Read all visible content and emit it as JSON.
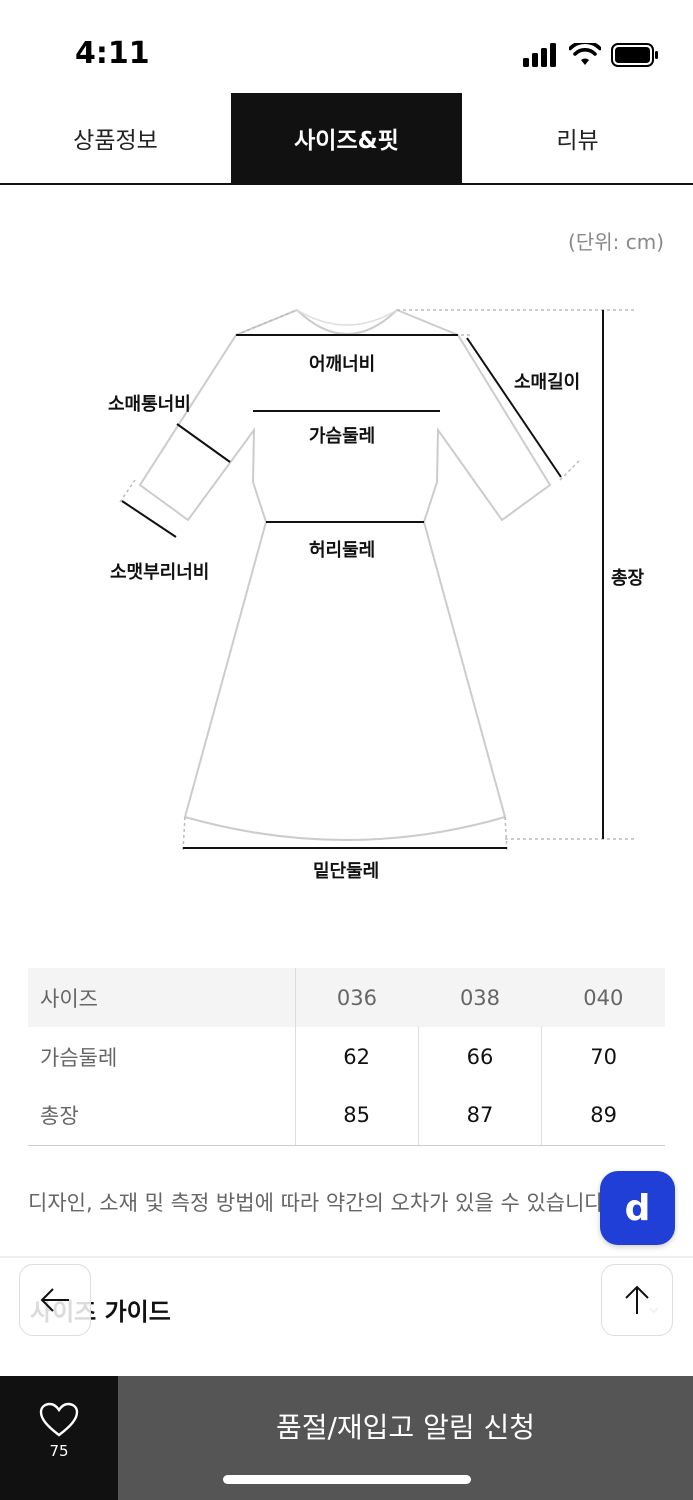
{
  "status_bar": {
    "time": "4:11"
  },
  "tabs": [
    {
      "label": "상품정보",
      "active": false
    },
    {
      "label": "사이즈&핏",
      "active": true
    },
    {
      "label": "리뷰",
      "active": false
    }
  ],
  "unit_label": "(단위: cm)",
  "diagram": {
    "shoulder": "어깨너비",
    "sleeve_length": "소매길이",
    "sleeve_width": "소매통너비",
    "chest": "가슴둘레",
    "cuff_width": "소맷부리너비",
    "waist": "허리둘레",
    "total_length": "총장",
    "hem": "밑단둘레"
  },
  "size_table": {
    "header_label": "사이즈",
    "sizes": [
      "036",
      "038",
      "040"
    ],
    "rows": [
      {
        "label": "가슴둘레",
        "values": [
          "62",
          "66",
          "70"
        ]
      },
      {
        "label": "총장",
        "values": [
          "85",
          "87",
          "89"
        ]
      }
    ]
  },
  "disclaimer": "디자인, 소재 및 측정 방법에 따라 약간의 오차가 있을 수 있습니다.",
  "fab_label": "d",
  "guide": {
    "title": "사이즈 가이드"
  },
  "bottom_bar": {
    "like_count": "75",
    "restock_label": "품절/재입고 알림 신청"
  },
  "colors": {
    "accent_blue": "#1f3fd6",
    "tab_active_bg": "#111111",
    "restock_bg": "#555555"
  }
}
